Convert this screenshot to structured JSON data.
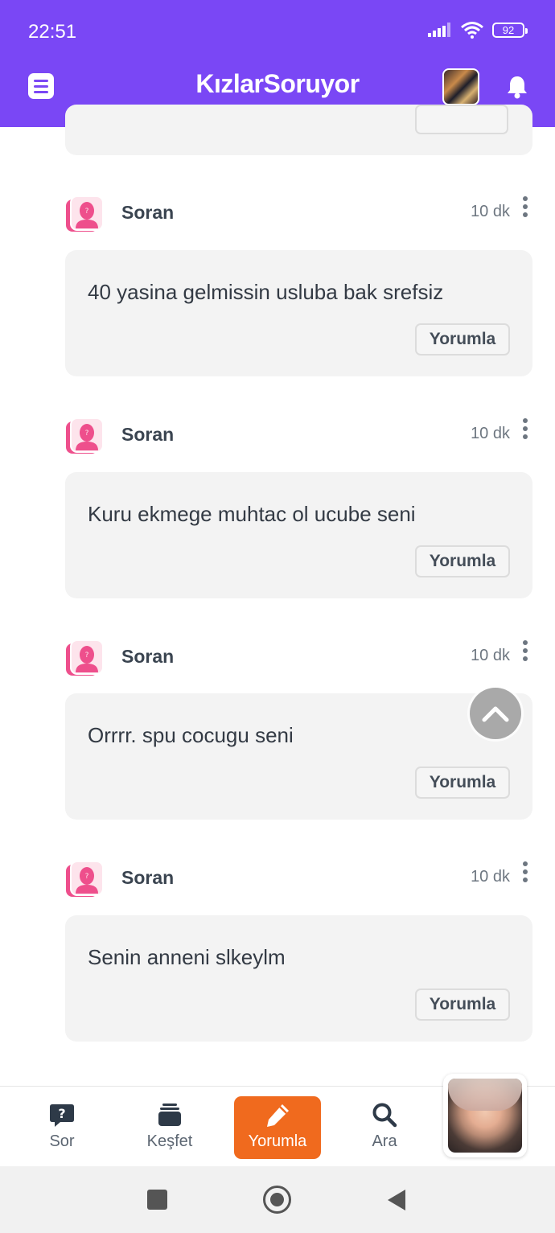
{
  "status_bar": {
    "time": "22:51",
    "battery": "92"
  },
  "header": {
    "logo": "KızlarSoruyor"
  },
  "comments": [
    {
      "author": "Soran",
      "time": "10 dk",
      "text": "40 yasina gelmissin usluba bak srefsiz",
      "reply_label": "Yorumla"
    },
    {
      "author": "Soran",
      "time": "10 dk",
      "text": "Kuru ekmege muhtac ol ucube seni",
      "reply_label": "Yorumla"
    },
    {
      "author": "Soran",
      "time": "10 dk",
      "text": "Orrrr. spu cocugu seni",
      "reply_label": "Yorumla"
    },
    {
      "author": "Soran",
      "time": "10 dk",
      "text": "Senin anneni slkeylm",
      "reply_label": "Yorumla"
    }
  ],
  "bottom_nav": {
    "items": [
      {
        "label": "Sor",
        "icon": "question-bubble-icon"
      },
      {
        "label": "Keşfet",
        "icon": "stack-icon"
      },
      {
        "label": "Yorumla",
        "icon": "pencil-icon",
        "active": true
      },
      {
        "label": "Ara",
        "icon": "search-icon"
      }
    ]
  },
  "colors": {
    "brand": "#7a47f5",
    "active_nav": "#f06a1e",
    "avatar_pink": "#ee4f8c"
  }
}
